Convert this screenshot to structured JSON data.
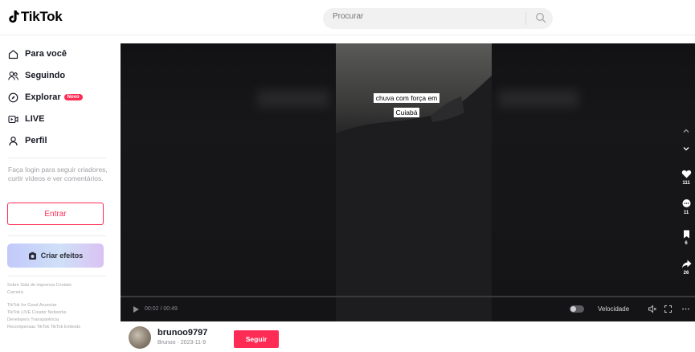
{
  "header": {
    "logo_text": "TikTok",
    "search": {
      "placeholder": "Procurar"
    }
  },
  "sidebar": {
    "items": [
      {
        "label": "Para você",
        "icon": "home-icon"
      },
      {
        "label": "Seguindo",
        "icon": "following-icon"
      },
      {
        "label": "Explorar",
        "icon": "compass-icon",
        "badge": "Novo"
      },
      {
        "label": "LIVE",
        "icon": "live-icon"
      },
      {
        "label": "Perfil",
        "icon": "profile-icon"
      }
    ],
    "login_prompt": "Faça login para seguir criadores, curtir vídeos e ver comentários.",
    "login_button": "Entrar",
    "effects_button": "Criar efeitos",
    "footer": {
      "line1": "Sobre  Sala de imprensa  Contato",
      "line2": "Carreira",
      "line3": "TikTok for Good  Anunciar",
      "line4": "TikTok LIVE Creator Networks",
      "line5": "Developers  Transparência",
      "line6": "Recompensas TikTok  TikTok Embeds"
    }
  },
  "video": {
    "caption": "chuva com força em Cuiabá",
    "timecode": "00:02 / 00:49",
    "speed_label": "Velocidade",
    "actions": {
      "likes": "111",
      "comments": "11",
      "saves": "6",
      "shares": "26"
    }
  },
  "author": {
    "username": "brunoo9797",
    "subline": "Brunoo · 2023-11-9",
    "follow_button": "Seguir"
  },
  "colors": {
    "accent": "#fe2c55",
    "text": "#161823"
  }
}
